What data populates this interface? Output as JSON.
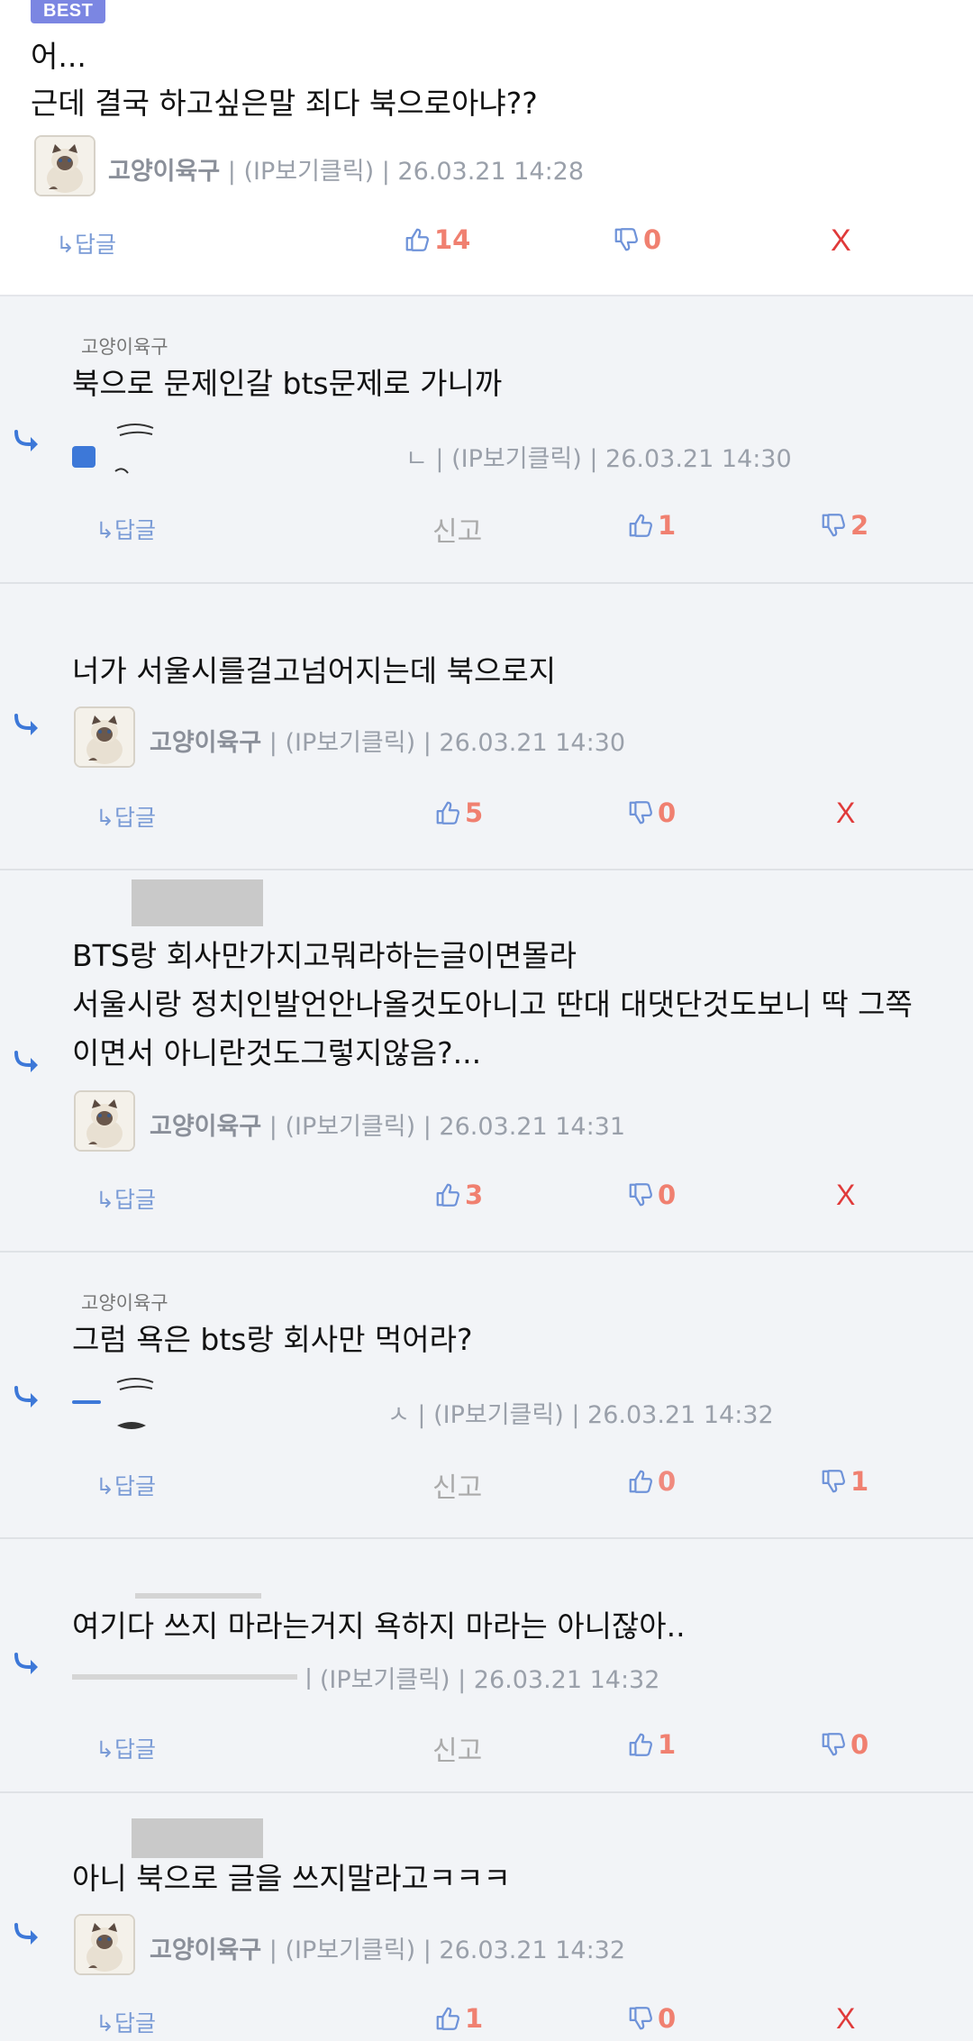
{
  "best": {
    "badge": "BEST",
    "line1": "어...",
    "line2": "근데 결국 하고싶은말 죄다 북으로아냐??",
    "author": "고양이육구",
    "meta": " | (IP보기클릭) | 26.03.21 14:28",
    "reply_label": "↳답글",
    "up": "14",
    "down": "0",
    "delete": "X"
  },
  "comments": [
    {
      "parent": "고양이육구",
      "lines": [
        "북으로 문제인갈 bts문제로 가니까"
      ],
      "author": "",
      "meta": "ㄴ | (IP보기클릭) | 26.03.21 14:30",
      "reply_label": "↳답글",
      "report": "신고",
      "up": "1",
      "down": "2"
    },
    {
      "parent": "",
      "lines": [
        "너가 서울시를걸고넘어지는데 북으로지"
      ],
      "author": "고양이육구",
      "meta": " | (IP보기클릭) | 26.03.21 14:30",
      "reply_label": "↳답글",
      "up": "5",
      "down": "0",
      "delete": "X"
    },
    {
      "parent": "",
      "lines": [
        "BTS랑 회사만가지고뭐라하는글이면몰라",
        "서울시랑 정치인발언안나올것도아니고 딴대 대댓단것도보니 딱 그쪽",
        "이면서 아니란것도그렇지않음?..."
      ],
      "author": "고양이육구",
      "meta": " | (IP보기클릭) | 26.03.21 14:31",
      "reply_label": "↳답글",
      "up": "3",
      "down": "0",
      "delete": "X"
    },
    {
      "parent": "고양이육구",
      "lines": [
        "그럼 욕은 bts랑 회사만 먹어라?"
      ],
      "author": "",
      "meta": "ㅅ | (IP보기클릭) | 26.03.21 14:32",
      "reply_label": "↳답글",
      "report": "신고",
      "up": "0",
      "down": "1"
    },
    {
      "parent": "",
      "lines": [
        "여기다 쓰지 마라는거지 욕하지 마라는 아니잖아.."
      ],
      "author": "",
      "meta": "ㅣ(IP보기클릭) | 26.03.21 14:32",
      "reply_label": "↳답글",
      "report": "신고",
      "up": "1",
      "down": "0"
    },
    {
      "parent": "",
      "lines": [
        "아니 북으로 글을 쓰지말라고ㅋㅋㅋ"
      ],
      "author": "고양이육구",
      "meta": " | (IP보기클릭) | 26.03.21 14:32",
      "reply_label": "↳답글",
      "up": "1",
      "down": "0",
      "delete": "X"
    }
  ],
  "colors": {
    "best_badge": "#7b86e2",
    "reply_bg": "#f2f4f7",
    "upvote": "#f08070",
    "delete": "#e03a3a",
    "reply_link": "#7a9bd6"
  },
  "icons": {
    "reply_arrow": "reply-arrow-icon",
    "thumbs_up": "thumbs-up-icon",
    "thumbs_down": "thumbs-down-icon",
    "avatar": "cat-avatar"
  }
}
